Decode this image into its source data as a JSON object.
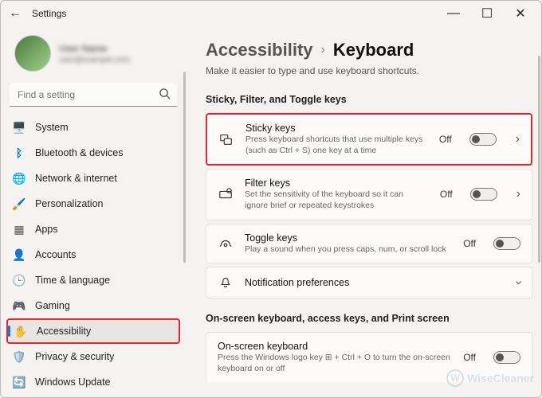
{
  "window": {
    "title": "Settings",
    "minimize": "—",
    "maximize": "☐",
    "close": "✕",
    "back": "←"
  },
  "profile": {
    "name": "User Name",
    "sub": "user@example.com"
  },
  "search": {
    "placeholder": "Find a setting"
  },
  "nav": [
    {
      "icon": "🖥️",
      "label": "System"
    },
    {
      "icon": "ᛒ",
      "label": "Bluetooth & devices"
    },
    {
      "icon": "🌐",
      "label": "Network & internet"
    },
    {
      "icon": "🖌️",
      "label": "Personalization"
    },
    {
      "icon": "▦",
      "label": "Apps"
    },
    {
      "icon": "👤",
      "label": "Accounts"
    },
    {
      "icon": "🕒",
      "label": "Time & language"
    },
    {
      "icon": "🎮",
      "label": "Gaming"
    },
    {
      "icon": "✋",
      "label": "Accessibility"
    },
    {
      "icon": "🛡️",
      "label": "Privacy & security"
    },
    {
      "icon": "🔄",
      "label": "Windows Update"
    }
  ],
  "breadcrumb": {
    "parent": "Accessibility",
    "sep": "›",
    "current": "Keyboard"
  },
  "subtitle": "Make it easier to type and use keyboard shortcuts.",
  "section1": "Sticky, Filter, and Toggle keys",
  "cards": {
    "sticky": {
      "title": "Sticky keys",
      "desc": "Press keyboard shortcuts that use multiple keys (such as Ctrl + S) one key at a time",
      "state": "Off"
    },
    "filter": {
      "title": "Filter keys",
      "desc": "Set the sensitivity of the keyboard so it can ignore brief or repeated keystrokes",
      "state": "Off"
    },
    "toggle": {
      "title": "Toggle keys",
      "desc": "Play a sound when you press caps, num, or scroll lock",
      "state": "Off"
    },
    "notif": {
      "title": "Notification preferences"
    }
  },
  "section2": "On-screen keyboard, access keys, and Print screen",
  "osk": {
    "title": "On-screen keyboard",
    "desc": "Press the Windows logo key ⊞ + Ctrl + O to turn the on-screen keyboard on or off",
    "state": "Off"
  },
  "watermark": {
    "w": "W",
    "text": "WiseCleaner"
  }
}
